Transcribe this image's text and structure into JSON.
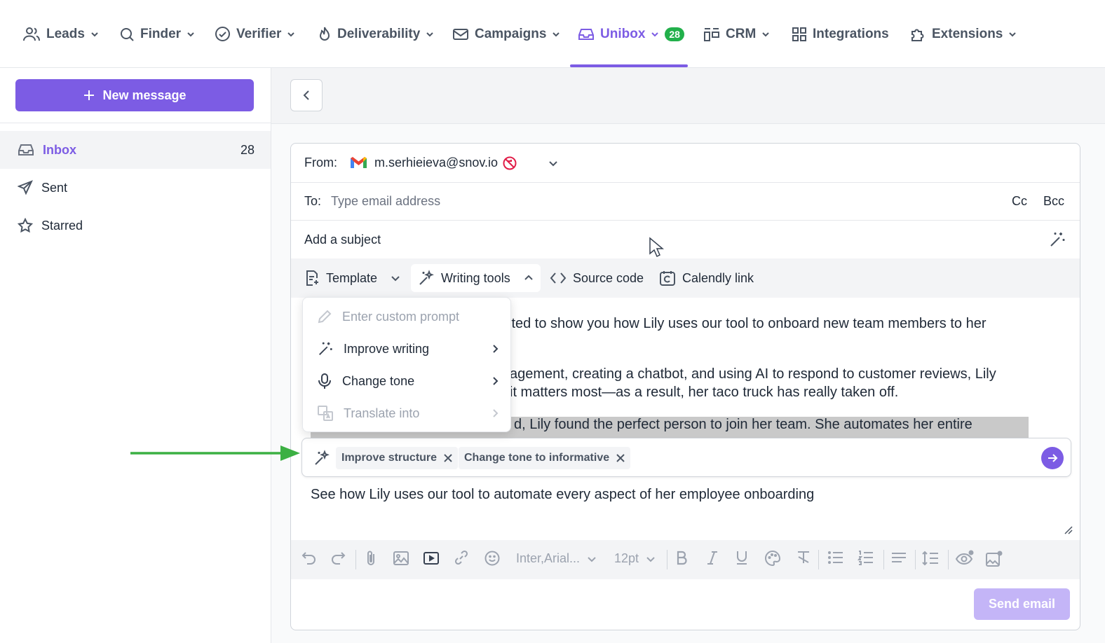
{
  "nav": {
    "leads": "Leads",
    "finder": "Finder",
    "verifier": "Verifier",
    "deliverability": "Deliverability",
    "campaigns": "Campaigns",
    "unibox": "Unibox",
    "unibox_badge": "28",
    "crm": "CRM",
    "integrations": "Integrations",
    "extensions": "Extensions",
    "accent": "#7c5ce4"
  },
  "sidebar": {
    "new_message": "New message",
    "items": [
      {
        "label": "Inbox",
        "count": "28"
      },
      {
        "label": "Sent"
      },
      {
        "label": "Starred"
      }
    ]
  },
  "compose": {
    "from_label": "From:",
    "from_email": "m.serhieieva@snov.io",
    "to_label": "To:",
    "to_placeholder": "Type email address",
    "cc": "Cc",
    "bcc": "Bcc",
    "subject_placeholder": "Add a subject",
    "toolbar": {
      "template": "Template",
      "writing_tools": "Writing tools",
      "source_code": "Source code",
      "calendly": "Calendly link"
    },
    "body": {
      "line1": "xcited to show you how Lily uses our tool to onboard new team members to her",
      "line2": "agement, creating a chatbot, and using AI to respond to customer reviews, Lily",
      "line3": "it matters most—as a result, her taco truck has really taken off.",
      "line4": "d, Lily found the perfect person to join her team. She automates her entire",
      "line5": "See how Lily uses our tool to automate every aspect of her employee onboarding"
    },
    "ai_chips": [
      "Improve structure",
      "Change tone to informative"
    ],
    "format_toolbar": {
      "font": "Inter,Arial...",
      "size": "12pt"
    },
    "send_email": "Send email"
  },
  "writing_tools_menu": {
    "custom_prompt": "Enter custom prompt",
    "improve_writing": "Improve writing",
    "change_tone": "Change tone",
    "translate_into": "Translate into"
  },
  "annotation_color": "#3cb043"
}
